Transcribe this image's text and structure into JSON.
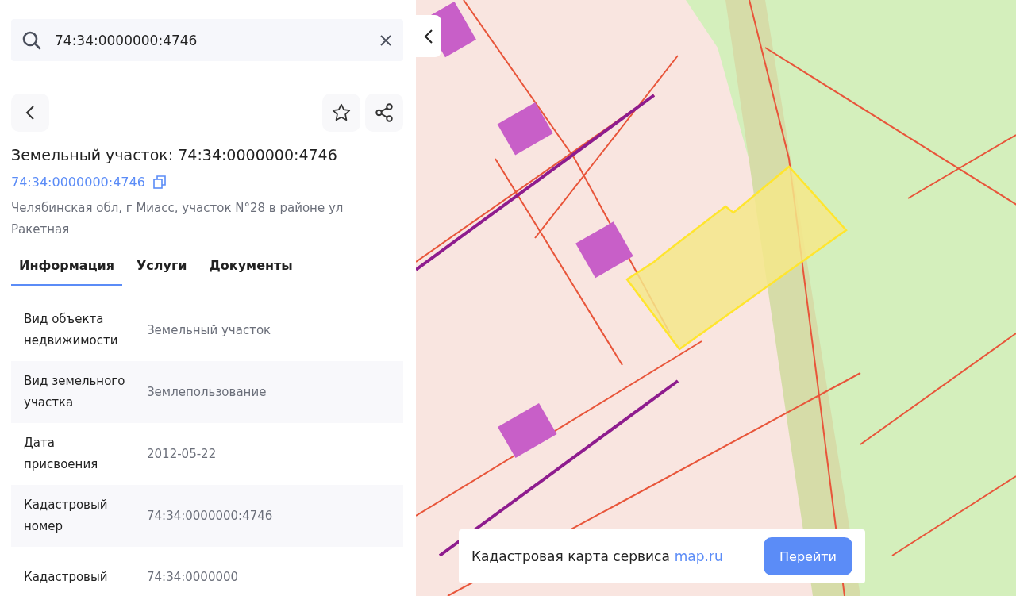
{
  "search": {
    "value": "74:34:0000000:4746"
  },
  "title": "Земельный участок: 74:34:0000000:4746",
  "cadastral_link": "74:34:0000000:4746",
  "address": "Челябинская обл, г Миасс, участок N°28 в районе ул Ракетная",
  "tabs": [
    {
      "label": "Информация",
      "selected": true
    },
    {
      "label": "Услуги",
      "selected": false
    },
    {
      "label": "Документы",
      "selected": false
    }
  ],
  "properties": [
    {
      "label": "Вид объекта недвижимости",
      "value": "Земельный участок"
    },
    {
      "label": "Вид земельного участка",
      "value": "Землепользование"
    },
    {
      "label": "Дата присвоения",
      "value": "2012-05-22"
    },
    {
      "label": "Кадастровый номер",
      "value": "74:34:0000000:4746"
    },
    {
      "label": "Кадастровый",
      "value": "74:34:0000000"
    }
  ],
  "map_banner": {
    "text": "Кадастровая карта сервиса",
    "link": "map.ru",
    "button": "Перейти"
  }
}
